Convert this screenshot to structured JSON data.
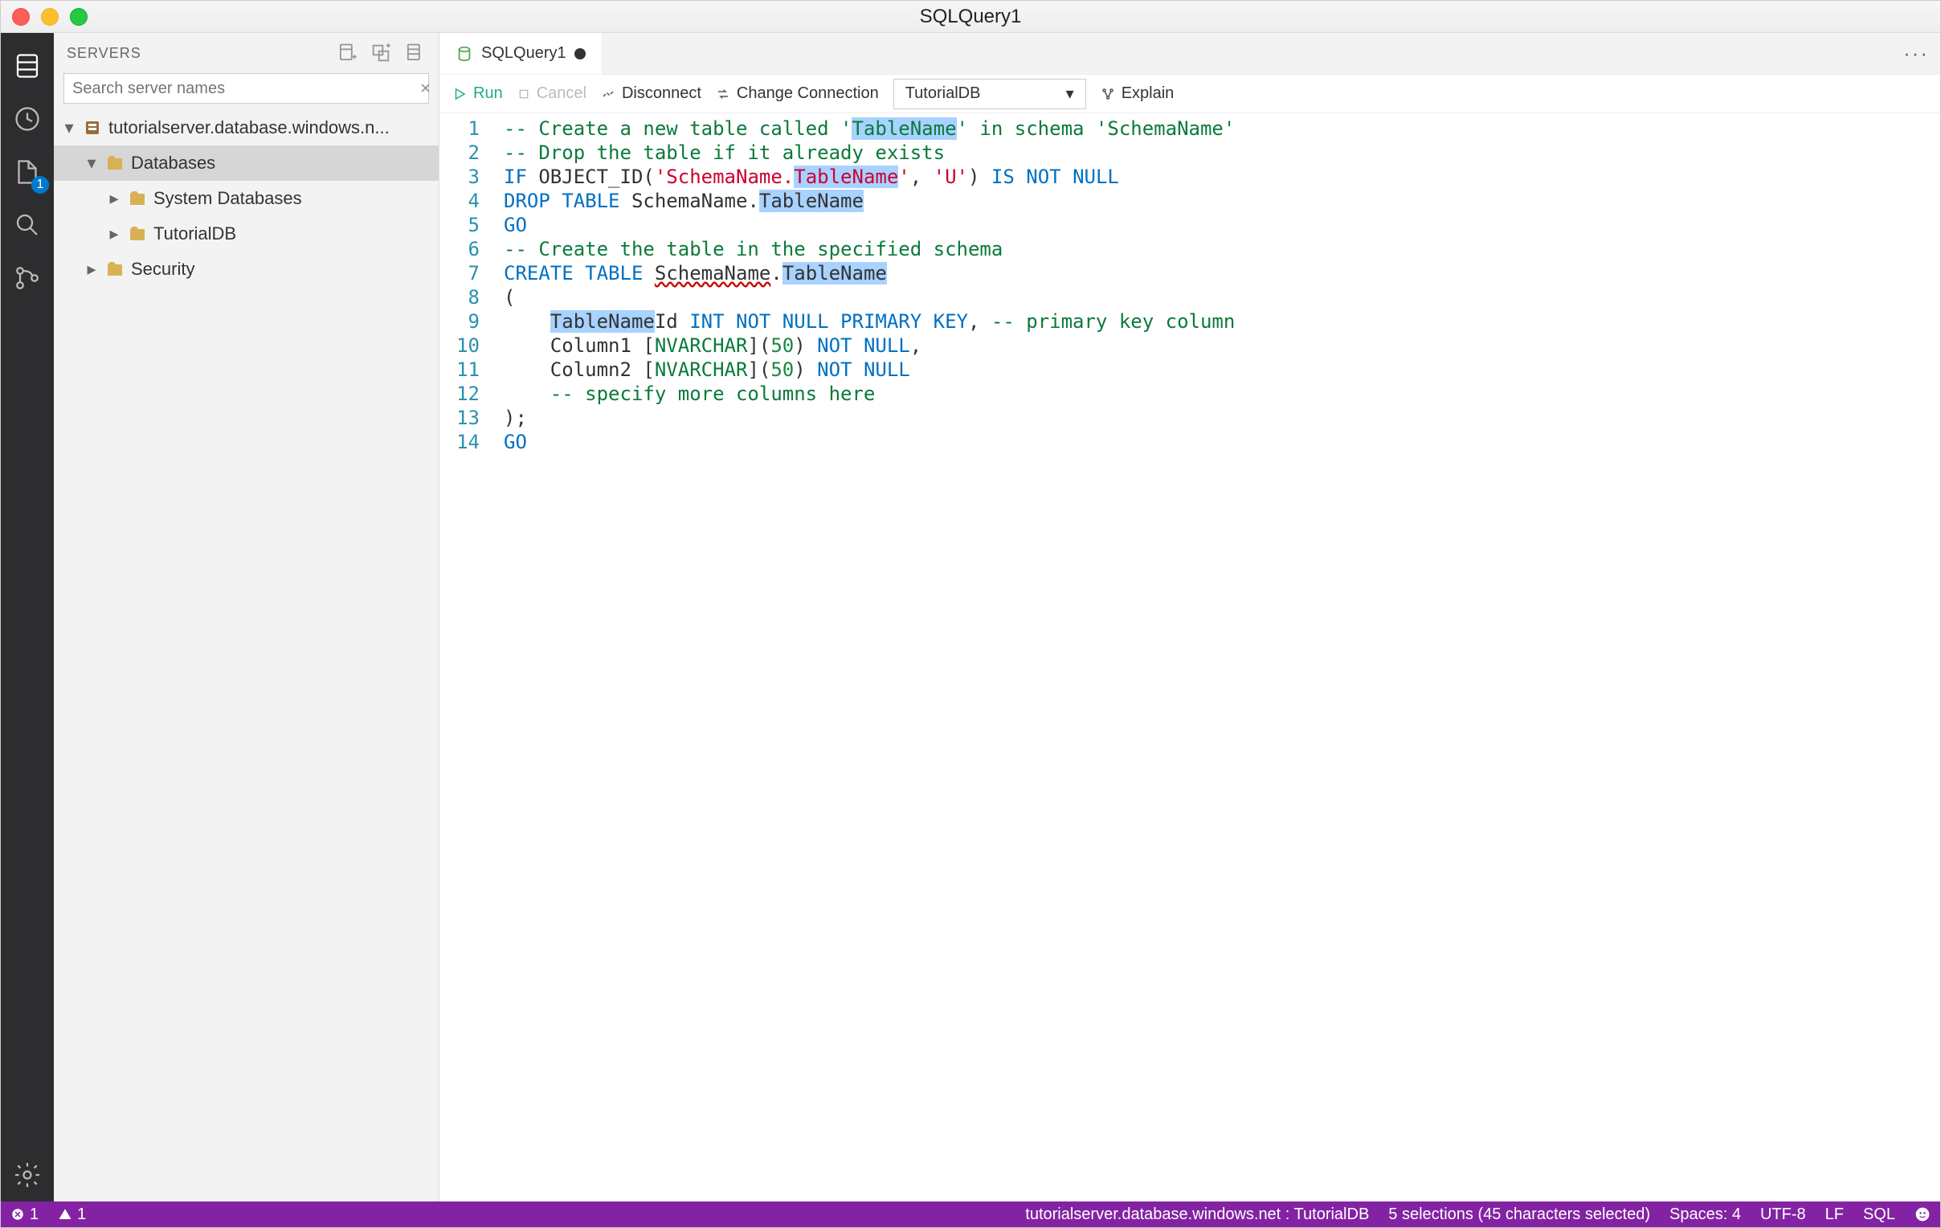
{
  "window": {
    "title": "SQLQuery1"
  },
  "activitybar": {
    "file_badge": "1"
  },
  "sidebar": {
    "header": "Servers",
    "search_placeholder": "Search server names",
    "tree": {
      "server": "tutorialserver.database.windows.n...",
      "db_root": "Databases",
      "sys_db": "System Databases",
      "tutorial_db": "TutorialDB",
      "security": "Security"
    }
  },
  "tabs": {
    "active": "SQLQuery1"
  },
  "toolbar": {
    "run": "Run",
    "cancel": "Cancel",
    "disconnect": "Disconnect",
    "change_conn": "Change Connection",
    "db": "TutorialDB",
    "explain": "Explain"
  },
  "code": {
    "lines": 14
  },
  "statusbar": {
    "errors": "1",
    "warnings": "1",
    "conn": "tutorialserver.database.windows.net : TutorialDB",
    "sel": "5 selections (45 characters selected)",
    "spaces": "Spaces: 4",
    "enc": "UTF-8",
    "eol": "LF",
    "lang": "SQL"
  }
}
